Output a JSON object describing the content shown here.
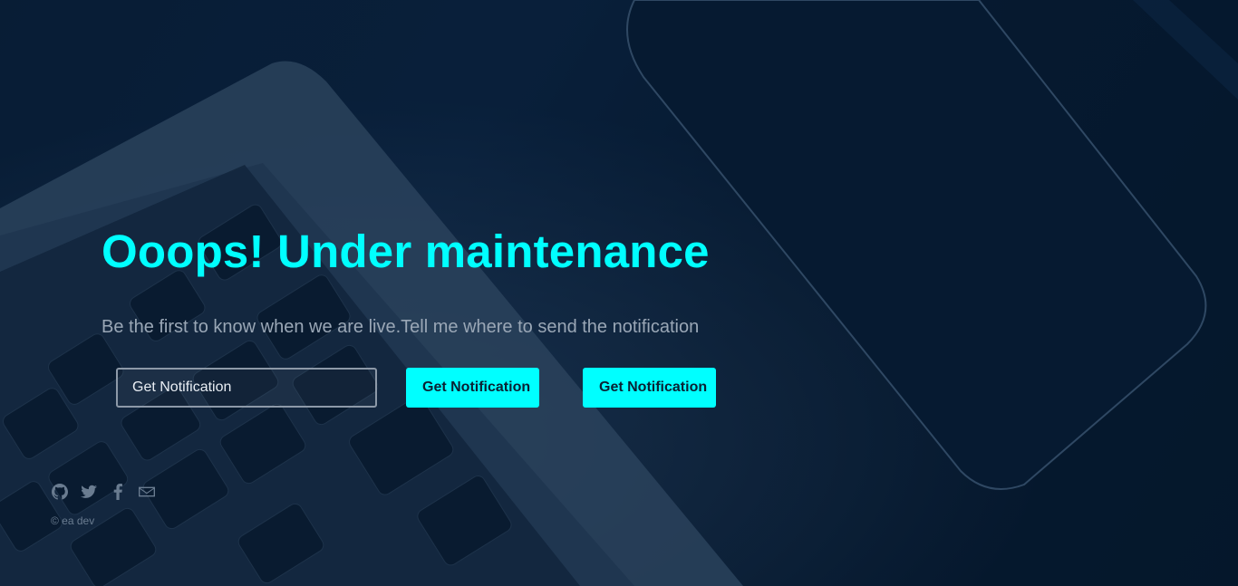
{
  "hero": {
    "headline": "Ooops! Under maintenance",
    "subtitle": "Be the first to know when we are live.Tell me where to send the notification"
  },
  "form": {
    "input_placeholder": "Get Notification",
    "primary_button_label": "Get Notification",
    "secondary_button_label": "Get Notification"
  },
  "footer": {
    "social_icons": [
      "github-icon",
      "twitter-icon",
      "facebook-icon",
      "mail-icon"
    ],
    "copyright": "© ea dev"
  },
  "colors": {
    "accent": "#00ffff",
    "background": "#071a30",
    "subtitle_text": "#9aa7b6",
    "icon_muted": "#6a7c90"
  }
}
